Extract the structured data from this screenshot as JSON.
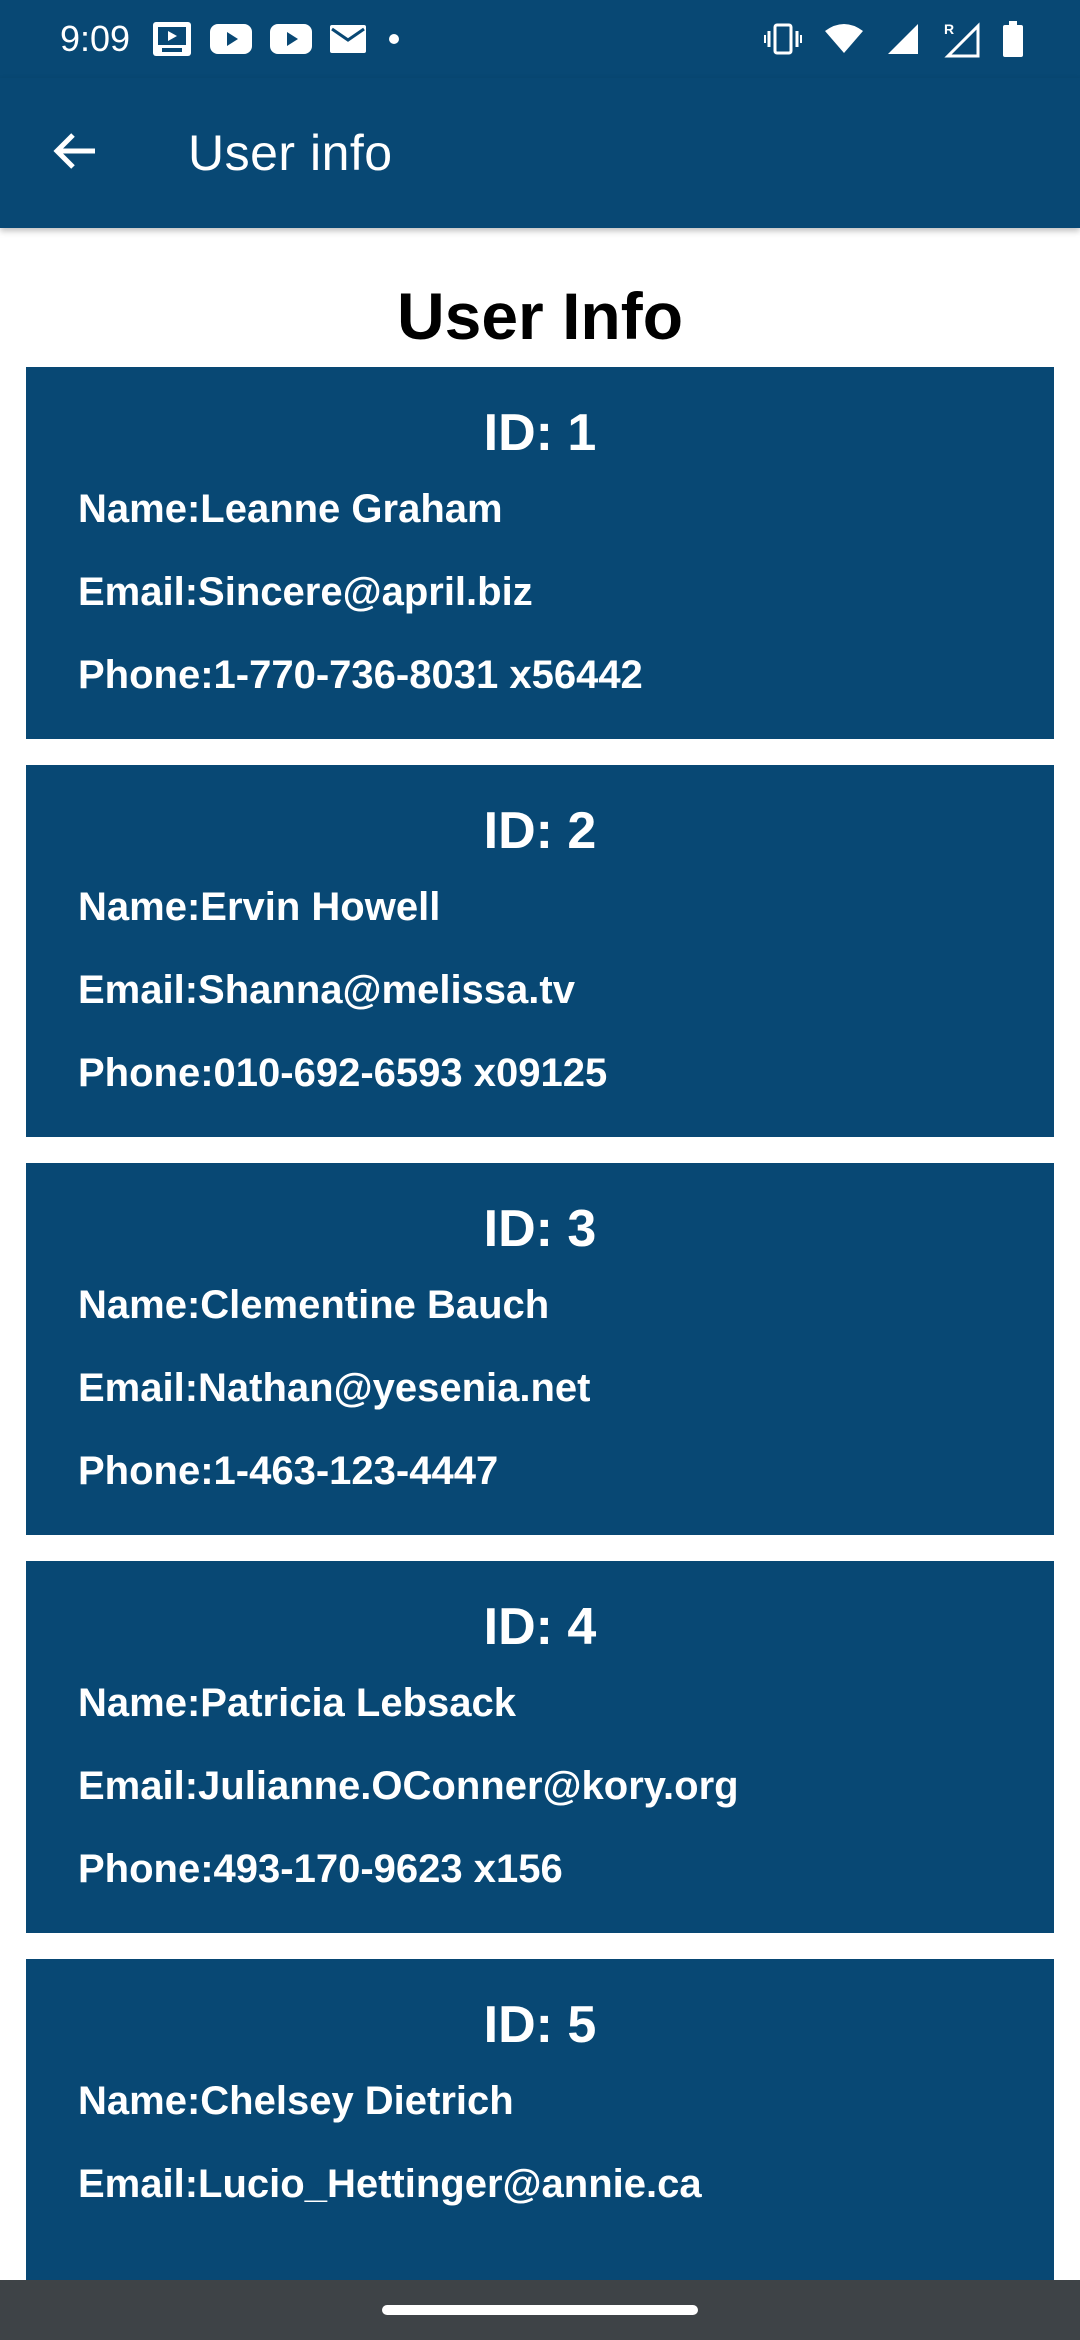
{
  "status_bar": {
    "time": "9:09",
    "icons_left": [
      "tv-app-icon",
      "youtube-icon",
      "youtube-icon",
      "mail-icon",
      "dot-icon"
    ],
    "icons_right": [
      "vibrate-icon",
      "wifi-icon",
      "signal-icon",
      "signal-roaming-icon",
      "battery-icon"
    ]
  },
  "app_bar": {
    "title": "User info",
    "back_icon": "arrow-left-icon"
  },
  "page": {
    "heading": "User Info"
  },
  "users": [
    {
      "id_label": "ID: 1",
      "name": "Name:Leanne Graham",
      "email": "Email:Sincere@april.biz",
      "phone": "Phone:1-770-736-8031 x56442"
    },
    {
      "id_label": "ID: 2",
      "name": "Name:Ervin Howell",
      "email": "Email:Shanna@melissa.tv",
      "phone": "Phone:010-692-6593 x09125"
    },
    {
      "id_label": "ID: 3",
      "name": "Name:Clementine Bauch",
      "email": "Email:Nathan@yesenia.net",
      "phone": "Phone:1-463-123-4447"
    },
    {
      "id_label": "ID: 4",
      "name": "Name:Patricia Lebsack",
      "email": "Email:Julianne.OConner@kory.org",
      "phone": "Phone:493-170-9623 x156"
    },
    {
      "id_label": "ID: 5",
      "name": "Name:Chelsey Dietrich",
      "email": "Email:Lucio_Hettinger@annie.ca"
    }
  ],
  "colors": {
    "primary": "#084874",
    "nav_bar": "#3e4347",
    "text_on_primary": "#ffffff"
  }
}
